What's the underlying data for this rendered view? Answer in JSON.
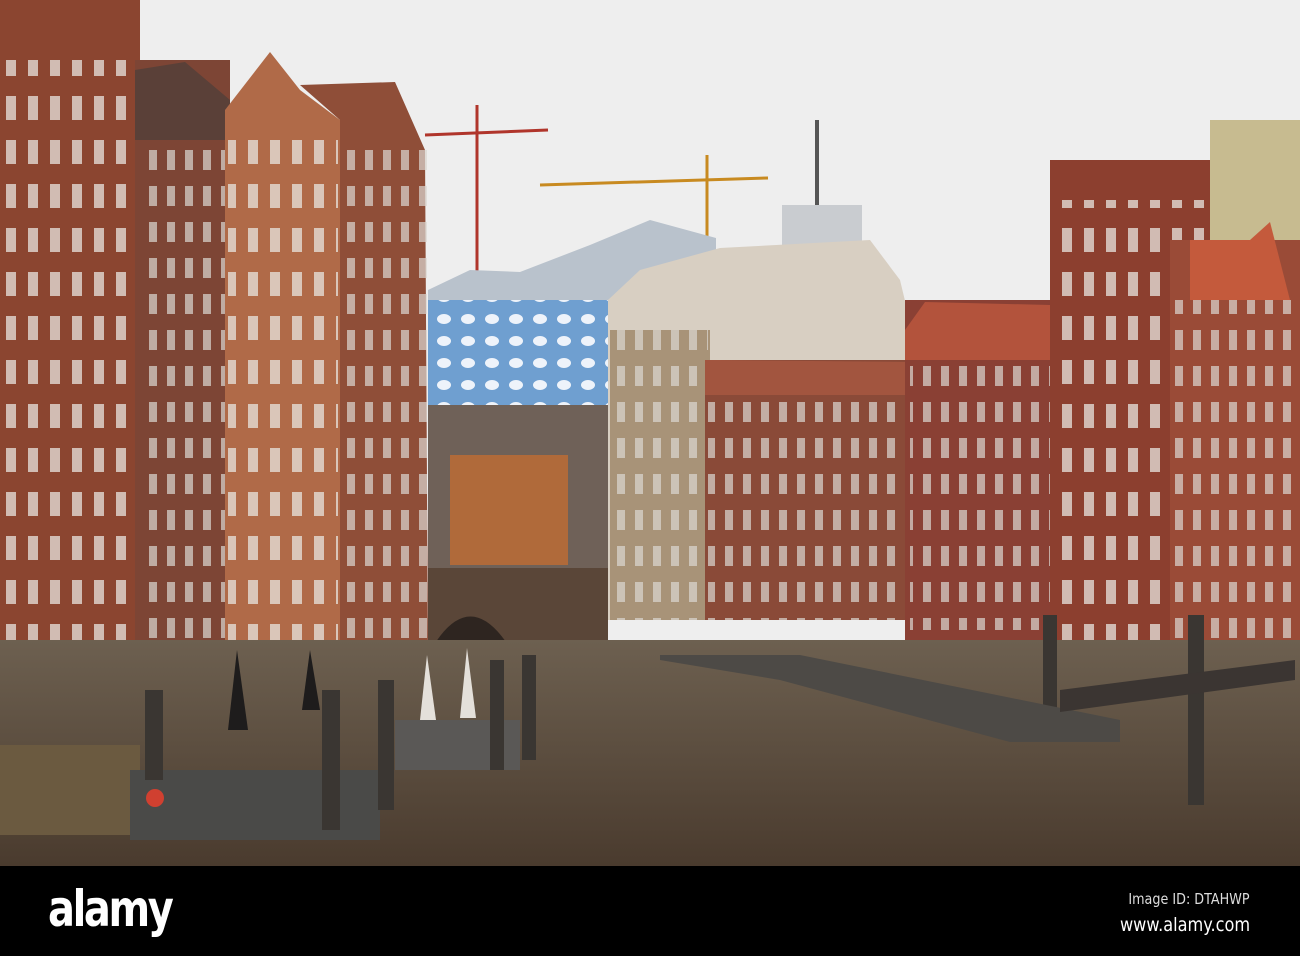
{
  "watermark": {
    "logo": "alamy",
    "image_id": "Image ID: DTAHWP",
    "website": "www.alamy.com"
  }
}
